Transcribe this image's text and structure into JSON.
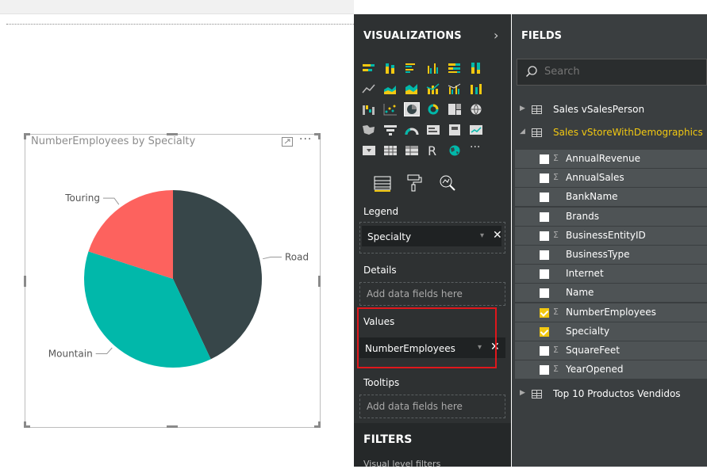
{
  "visual": {
    "title": "NumberEmployees by Specialty",
    "more_label": "···"
  },
  "chart_data": {
    "type": "pie",
    "title": "NumberEmployees by Specialty",
    "categories": [
      "Road",
      "Mountain",
      "Touring"
    ],
    "values": [
      43,
      37,
      20
    ],
    "colors": [
      "#374649",
      "#01b8aa",
      "#fd625e"
    ]
  },
  "visualizations": {
    "title": "VISUALIZATIONS",
    "collapse_icon": "chevron-right-icon",
    "gallery_selected": "pie-chart-icon",
    "r_visual_label": "R",
    "more_visuals_label": "···",
    "legend_label": "Legend",
    "legend_field": "Specialty",
    "details_label": "Details",
    "details_placeholder": "Add data fields here",
    "values_label": "Values",
    "values_field": "NumberEmployees",
    "tooltips_label": "Tooltips",
    "tooltips_placeholder": "Add data fields here",
    "remove_label": "✕",
    "dropdown_label": "▾",
    "highlight_color": "#e0171c"
  },
  "filters": {
    "title": "FILTERS",
    "sub": "Visual level filters"
  },
  "fields": {
    "title": "FIELDS",
    "search_placeholder": "Search",
    "tables": [
      {
        "name": "Sales vSalesPerson",
        "expanded": false
      },
      {
        "name": "Sales vStoreWithDemographics",
        "expanded": true
      },
      {
        "name": "Top 10 Productos Vendidos",
        "expanded": false
      }
    ],
    "columns": [
      {
        "name": "AnnualRevenue",
        "sigma": true,
        "checked": false
      },
      {
        "name": "AnnualSales",
        "sigma": true,
        "checked": false
      },
      {
        "name": "BankName",
        "sigma": false,
        "checked": false
      },
      {
        "name": "Brands",
        "sigma": false,
        "checked": false
      },
      {
        "name": "BusinessEntityID",
        "sigma": true,
        "checked": false
      },
      {
        "name": "BusinessType",
        "sigma": false,
        "checked": false
      },
      {
        "name": "Internet",
        "sigma": false,
        "checked": false
      },
      {
        "name": "Name",
        "sigma": false,
        "checked": false
      },
      {
        "name": "NumberEmployees",
        "sigma": true,
        "checked": true
      },
      {
        "name": "Specialty",
        "sigma": false,
        "checked": true
      },
      {
        "name": "SquareFeet",
        "sigma": true,
        "checked": false
      },
      {
        "name": "YearOpened",
        "sigma": true,
        "checked": false
      }
    ],
    "sigma_glyph": "Σ",
    "accent": "#f2c811"
  }
}
